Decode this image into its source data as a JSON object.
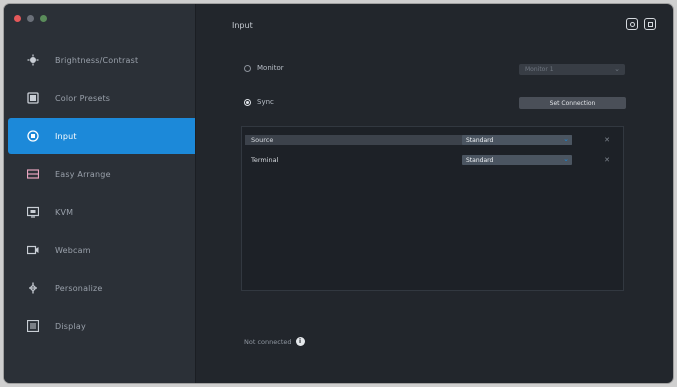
{
  "window": {
    "title": "Input"
  },
  "sidebar": {
    "items": [
      {
        "label": "Brightness/Contrast",
        "icon": "brightness-icon"
      },
      {
        "label": "Color Presets",
        "icon": "color-presets-icon"
      },
      {
        "label": "Input",
        "icon": "input-icon"
      },
      {
        "label": "Easy Arrange",
        "icon": "easy-arrange-icon"
      },
      {
        "label": "KVM",
        "icon": "kvm-icon"
      },
      {
        "label": "Webcam",
        "icon": "webcam-icon"
      },
      {
        "label": "Personalize",
        "icon": "personalize-icon"
      },
      {
        "label": "Display",
        "icon": "display-icon"
      }
    ]
  },
  "main": {
    "options": [
      {
        "label": "Monitor",
        "selected": false
      },
      {
        "label": "Sync",
        "selected": true
      }
    ],
    "monitor_select": {
      "value": "Monitor 1"
    },
    "sync_button": {
      "label": "Set Connection"
    },
    "monitors": [
      {
        "name": "Source",
        "value": "Standard"
      },
      {
        "name": "Terminal",
        "value": "Standard"
      }
    ],
    "footer": {
      "text": "Not connected"
    }
  },
  "colors": {
    "accent": "#1c89d9",
    "background": "#22262c",
    "sidebar": "#2b3037"
  }
}
